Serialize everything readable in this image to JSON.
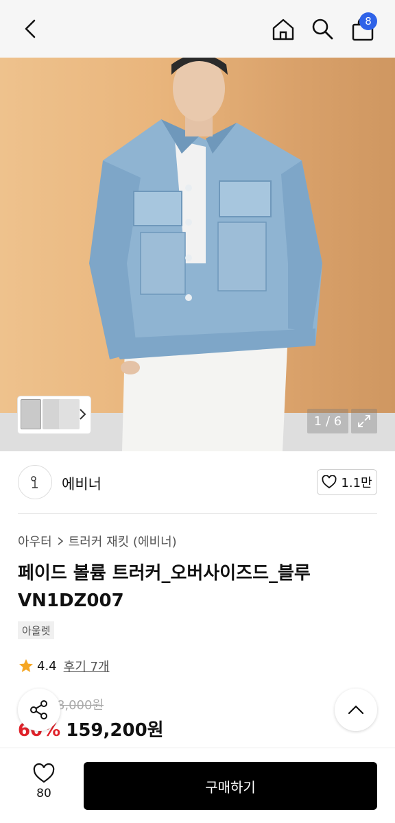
{
  "header": {
    "cart_count": "8"
  },
  "gallery": {
    "counter": "1 / 6"
  },
  "brand": {
    "name": "에비너",
    "likes": "1.1만"
  },
  "product": {
    "breadcrumb": [
      "아우터",
      "트러커 재킷 (에비너)"
    ],
    "title": "페이드 볼륨 트러커_오버사이즈드_블루 VN1DZ007",
    "tag": "아울렛",
    "rating": "4.4",
    "review_link": "후기 7개",
    "original_price": "398,000원",
    "discount": "60%",
    "price": "159,200원"
  },
  "bottom": {
    "wish_count": "80",
    "buy_label": "구매하기"
  },
  "colors": {
    "badge": "#2f63e8",
    "discount": "#e0222a",
    "buy_button": "#000000",
    "star": "#f5a623"
  }
}
